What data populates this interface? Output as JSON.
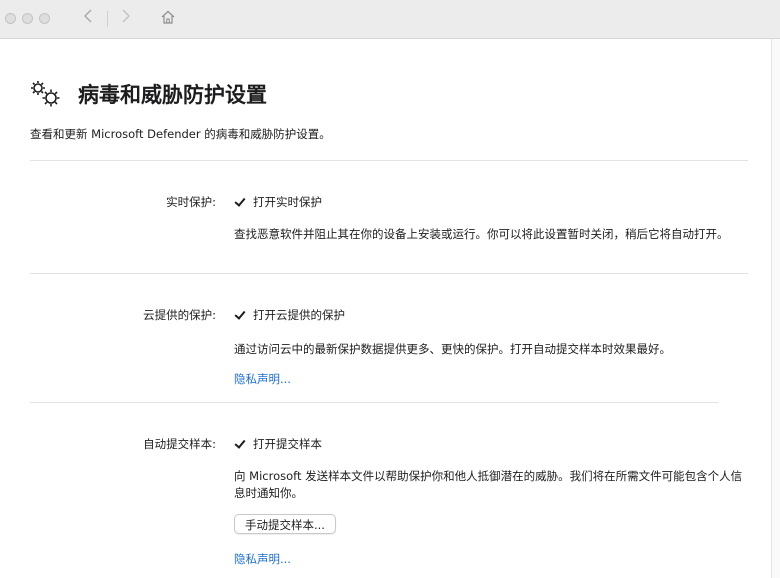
{
  "window": {
    "back_icon": "chevron-left-icon",
    "forward_icon": "chevron-right-icon",
    "home_icon": "home-icon"
  },
  "page": {
    "title": "病毒和威胁防护设置",
    "title_icon": "gears-icon",
    "description": "查看和更新 Microsoft Defender 的病毒和威胁防护设置。"
  },
  "sections": {
    "realtime": {
      "label": "实时保护:",
      "checkbox_label": "打开实时保护",
      "checked": true,
      "description": "查找恶意软件并阻止其在你的设备上安装或运行。你可以将此设置暂时关闭，稍后它将自动打开。"
    },
    "cloud": {
      "label": "云提供的保护:",
      "checkbox_label": "打开云提供的保护",
      "checked": true,
      "description": "通过访问云中的最新保护数据提供更多、更快的保护。打开自动提交样本时效果最好。",
      "link": "隐私声明..."
    },
    "sample": {
      "label": "自动提交样本:",
      "checkbox_label": "打开提交样本",
      "checked": true,
      "description": "向 Microsoft 发送样本文件以帮助保护你和他人抵御潜在的威胁。我们将在所需文件可能包含个人信息时通知你。",
      "button": "手动提交样本...",
      "link": "隐私声明..."
    }
  },
  "colors": {
    "link": "#1b6ed6",
    "titlebar": "#ececec"
  }
}
